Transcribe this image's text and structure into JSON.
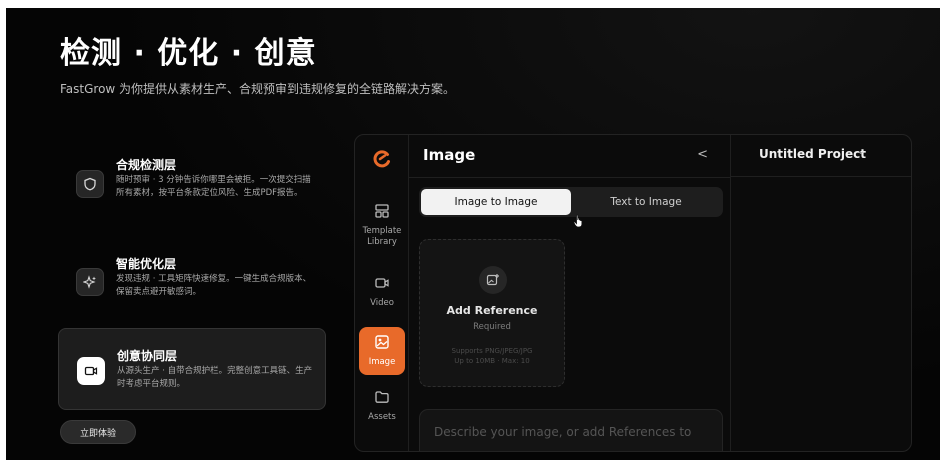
{
  "hero": {
    "title": "检测 · 优化 · 创意",
    "subtitle": "FastGrow 为你提供从素材生产、合规预审到违规修复的全链路解决方案。"
  },
  "features": [
    {
      "title": "合规检测层",
      "desc": "随时预审 · 3 分钟告诉你哪里会被拒。一次提交扫描所有素材，按平台条款定位风险、生成PDF报告。",
      "icon": "shield-icon"
    },
    {
      "title": "智能优化层",
      "desc": "发现违规 · 工具矩阵快速修复。一键生成合规版本、保留卖点避开敏感词。",
      "icon": "sparkle-icon"
    },
    {
      "title": "创意协同层",
      "desc": "从源头生产 · 自带合规护栏。完整创意工具链、生产时考虑平台规则。",
      "icon": "video-icon"
    }
  ],
  "cta_label": "立即体验",
  "app": {
    "rail": [
      {
        "label": "Template Library",
        "icon": "template-library-icon",
        "active": false
      },
      {
        "label": "Video",
        "icon": "video-icon",
        "active": false
      },
      {
        "label": "Image",
        "icon": "image-icon",
        "active": true
      },
      {
        "label": "Assets",
        "icon": "folder-icon",
        "active": false
      }
    ],
    "panel_title": "Image",
    "collapse_glyph": "<",
    "tabs": [
      "Image to Image",
      "Text to Image"
    ],
    "active_tab": "Image to Image",
    "upload": {
      "title": "Add Reference",
      "required": "Required",
      "hint_line1": "Supports PNG/JPEG/JPG",
      "hint_line2": "Up to 10MB · Max: 10"
    },
    "prompt_placeholder": "Describe your image, or add References to",
    "project_title": "Untitled Project",
    "project_chevron": "⌄",
    "accent": "#e86a2a"
  }
}
